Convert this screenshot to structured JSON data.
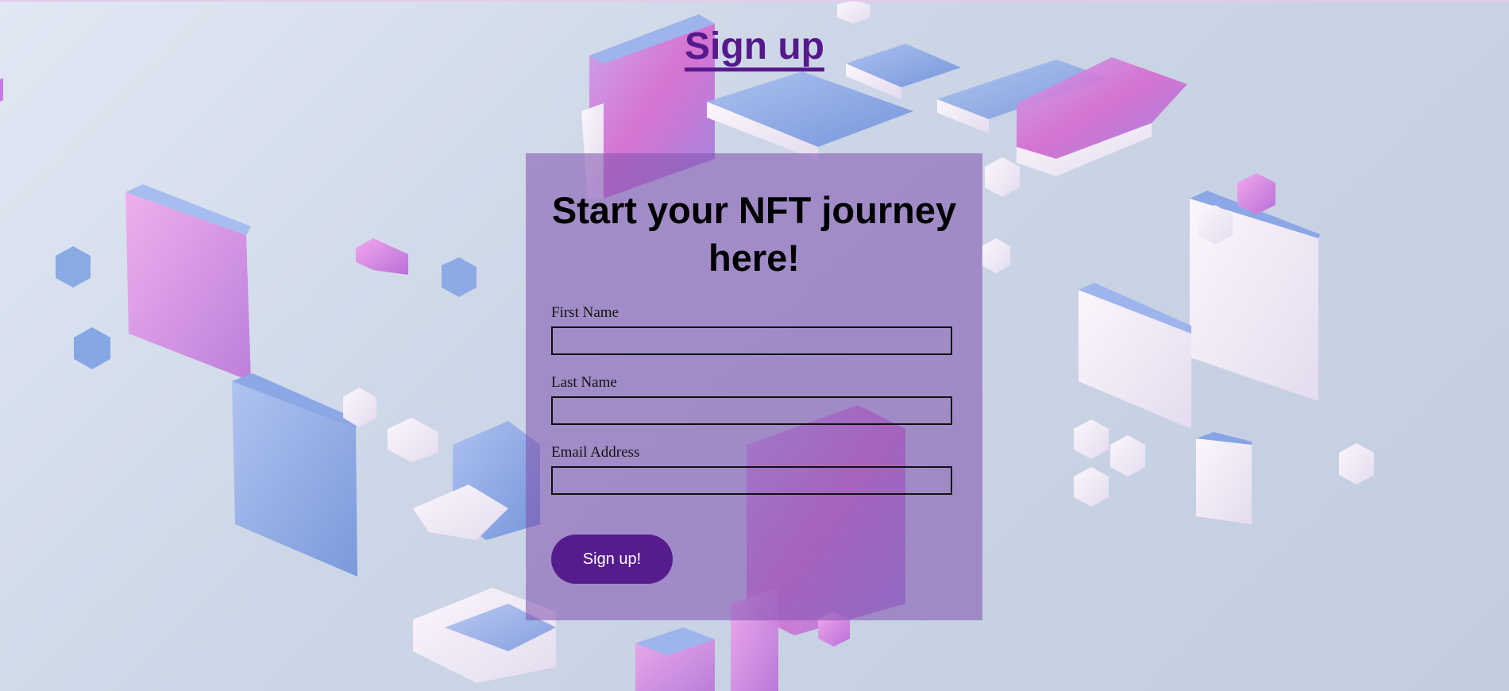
{
  "header": {
    "title": "Sign up"
  },
  "form": {
    "heading": "Start your NFT journey here!",
    "fields": [
      {
        "label": "First Name",
        "value": "",
        "placeholder": ""
      },
      {
        "label": "Last Name",
        "value": "",
        "placeholder": ""
      },
      {
        "label": "Email Address",
        "value": "",
        "placeholder": ""
      }
    ],
    "submit_label": "Sign up!"
  },
  "colors": {
    "accent": "#56198c",
    "panel": "#8052ae",
    "background": "#ccd6e6",
    "cube_pink": "#e07ad6",
    "cube_blue": "#7f9fdc",
    "cube_white": "#f1e9f4"
  }
}
